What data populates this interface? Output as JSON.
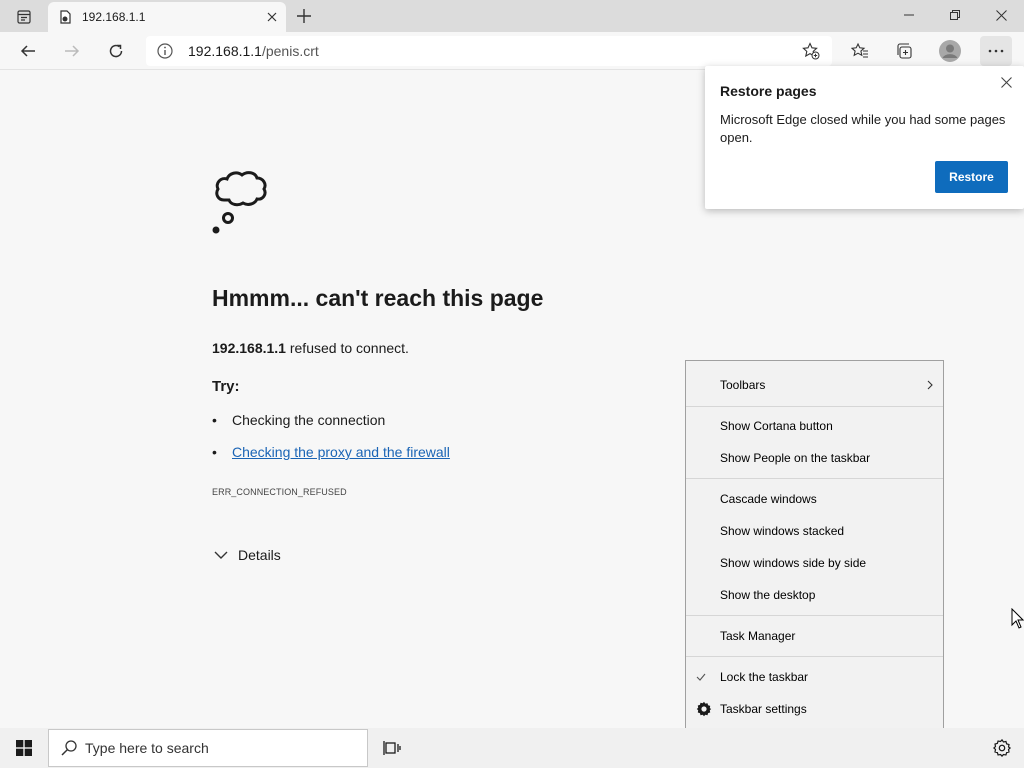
{
  "browser": {
    "tab_title": "192.168.1.1",
    "address_host": "192.168.1.1",
    "address_path": "/penis.crt"
  },
  "error_page": {
    "title": "Hmmm... can't reach this page",
    "host": "192.168.1.1",
    "message_rest": " refused to connect.",
    "try_label": "Try:",
    "suggestions": [
      "Checking the connection",
      "Checking the proxy and the firewall"
    ],
    "error_code": "ERR_CONNECTION_REFUSED",
    "details_label": "Details"
  },
  "restore_popup": {
    "title": "Restore pages",
    "body": "Microsoft Edge closed while you had some pages open.",
    "button_label": "Restore"
  },
  "context_menu": {
    "items": [
      {
        "label": "Toolbars",
        "submenu": true
      },
      {
        "label": "Show Cortana button"
      },
      {
        "label": "Show People on the taskbar"
      },
      {
        "label": "Cascade windows"
      },
      {
        "label": "Show windows stacked"
      },
      {
        "label": "Show windows side by side"
      },
      {
        "label": "Show the desktop"
      },
      {
        "label": "Task Manager"
      },
      {
        "label": "Lock the taskbar",
        "checked": true
      },
      {
        "label": "Taskbar settings",
        "icon": "gear-icon"
      }
    ]
  },
  "taskbar": {
    "search_placeholder": "Type here to search"
  },
  "colors": {
    "accent": "#0f6cbd",
    "link": "#1a64b5"
  }
}
